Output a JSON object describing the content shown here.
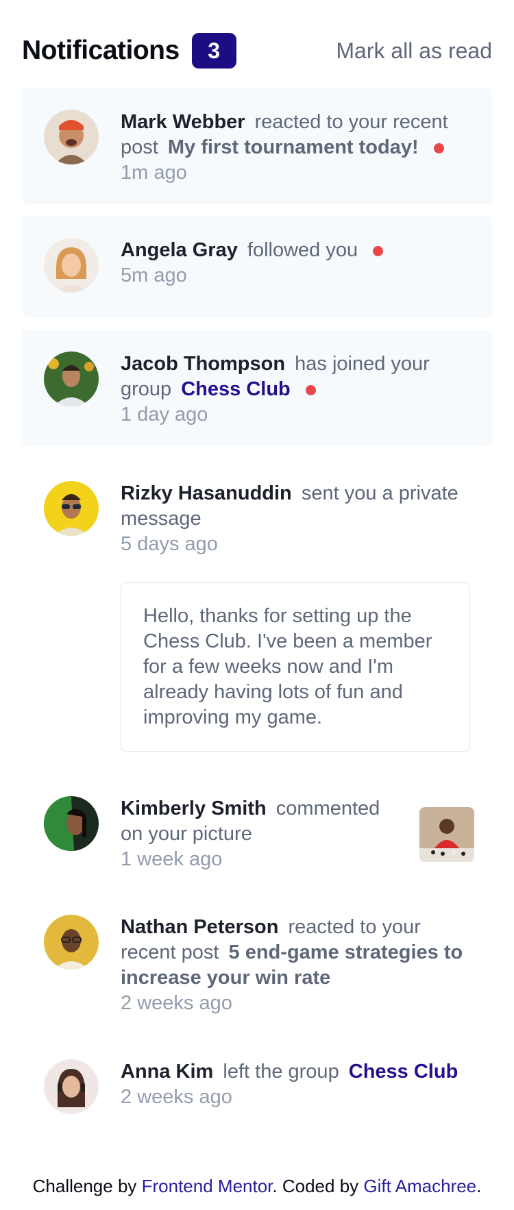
{
  "header": {
    "title": "Notifications",
    "badge_count": "3",
    "mark_all_label": "Mark all as read"
  },
  "notifications": [
    {
      "name": "Mark Webber",
      "action": "reacted to your recent post",
      "target": "My first tournament today!",
      "time": "1m ago",
      "unread": true
    },
    {
      "name": "Angela Gray",
      "action": "followed you",
      "time": "5m ago",
      "unread": true
    },
    {
      "name": "Jacob Thompson",
      "action": "has joined your group",
      "target": "Chess Club",
      "time": "1 day ago",
      "unread": true
    },
    {
      "name": "Rizky Hasanuddin",
      "action": "sent you a private message",
      "time": "5 days ago",
      "unread": false,
      "message": "Hello, thanks for setting up the Chess Club. I've been a member for a few weeks now and I'm already having lots of fun and improving my game."
    },
    {
      "name": "Kimberly Smith",
      "action": "commented on your picture",
      "time": "1 week ago",
      "unread": false
    },
    {
      "name": "Nathan Peterson",
      "action": "reacted to your recent post",
      "target": "5 end-game strategies to increase your win rate",
      "time": "2 weeks ago",
      "unread": false
    },
    {
      "name": "Anna Kim",
      "action": "left the group",
      "target": "Chess Club",
      "time": "2 weeks ago",
      "unread": false
    }
  ],
  "footer": {
    "prefix": "Challenge by ",
    "link1": "Frontend Mentor",
    "middle": ". Coded by ",
    "link2": "Gift Amachree",
    "suffix": "."
  },
  "colors": {
    "accent": "#240f8c",
    "unread_bg": "#f7fafd",
    "dot": "#e9464a"
  }
}
